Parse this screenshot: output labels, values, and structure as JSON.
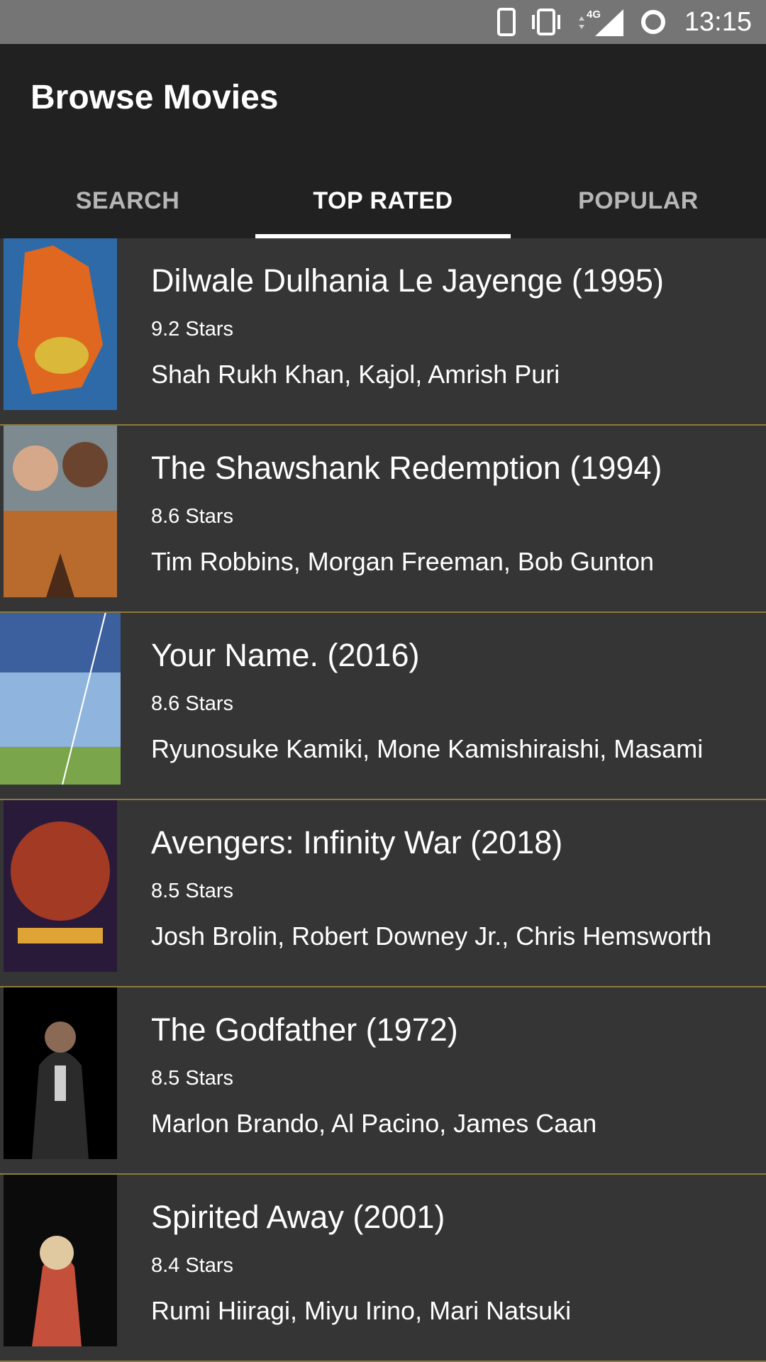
{
  "status_bar": {
    "time": "13:15",
    "network": "4G",
    "icons": [
      "phone-icon",
      "vibrate-icon",
      "signal-4g-icon",
      "loading-ring-icon"
    ]
  },
  "app_bar": {
    "title": "Browse Movies"
  },
  "tabs": [
    {
      "label": "SEARCH",
      "active": false
    },
    {
      "label": "TOP RATED",
      "active": true
    },
    {
      "label": "POPULAR",
      "active": false
    }
  ],
  "movies": [
    {
      "title": "Dilwale Dulhania Le Jayenge (1995)",
      "rating": "9.2 Stars",
      "cast": "Shah Rukh Khan, Kajol, Amrish Puri",
      "poster_colors": [
        "#2f6aa8",
        "#e0671f",
        "#d9b83a"
      ]
    },
    {
      "title": "The Shawshank Redemption (1994)",
      "rating": "8.6 Stars",
      "cast": "Tim Robbins, Morgan Freeman, Bob Gunton",
      "poster_colors": [
        "#7d8a8f",
        "#b86b2c",
        "#4a2a18"
      ]
    },
    {
      "title": "Your Name. (2016)",
      "rating": "8.6 Stars",
      "cast": "Ryunosuke Kamiki, Mone Kamishiraishi, Masami Nagasawa",
      "poster_colors": [
        "#3c5f9e",
        "#8fb4dd",
        "#7aa54a"
      ]
    },
    {
      "title": "Avengers: Infinity War (2018)",
      "rating": "8.5 Stars",
      "cast": "Josh Brolin, Robert Downey Jr., Chris Hemsworth",
      "poster_colors": [
        "#2a1a3a",
        "#c2421e",
        "#e0a436"
      ]
    },
    {
      "title": "The Godfather (1972)",
      "rating": "8.5 Stars",
      "cast": "Marlon Brando, Al Pacino, James Caan",
      "poster_colors": [
        "#000000",
        "#2b2b2b",
        "#cfcfcf"
      ]
    },
    {
      "title": "Spirited Away (2001)",
      "rating": "8.4 Stars",
      "cast": "Rumi Hiiragi, Miyu Irino, Mari Natsuki",
      "poster_colors": [
        "#0b0b0b",
        "#c4503c",
        "#e0c8a0"
      ]
    }
  ],
  "colors": {
    "status_bar": "#757575",
    "app_bar": "#212121",
    "list_bg": "#353535",
    "divider": "#8c7a3a",
    "tab_inactive": "#b6b6b6",
    "tab_active": "#ffffff"
  }
}
